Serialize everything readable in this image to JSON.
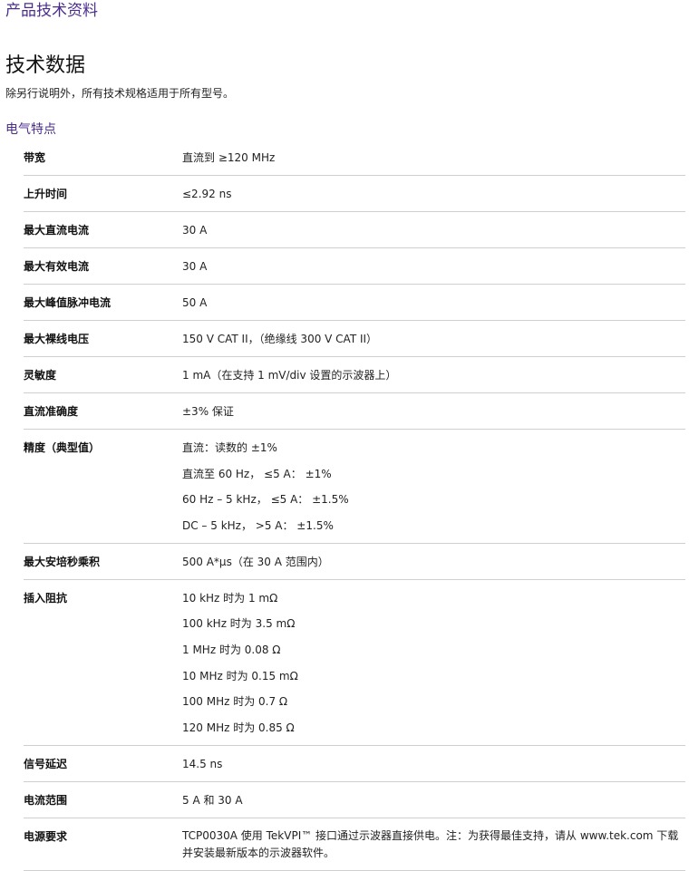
{
  "header": {
    "doc_label": "产品技术资料"
  },
  "section": {
    "title": "技术数据",
    "intro": "除另行说明外，所有技术规格适用于所有型号。",
    "subsection": "电气特点"
  },
  "specs": [
    {
      "label": "带宽",
      "values": [
        "直流到 ≥120 MHz"
      ]
    },
    {
      "label": "上升时间",
      "values": [
        "≤2.92 ns"
      ]
    },
    {
      "label": "最大直流电流",
      "values": [
        "30 A"
      ]
    },
    {
      "label": "最大有效电流",
      "values": [
        "30 A"
      ]
    },
    {
      "label": "最大峰值脉冲电流",
      "values": [
        "50 A"
      ]
    },
    {
      "label": "最大裸线电压",
      "values": [
        "150 V CAT II，（绝缘线 300 V CAT II）"
      ]
    },
    {
      "label": "灵敏度",
      "values": [
        "1 mA（在支持 1 mV/div 设置的示波器上）"
      ]
    },
    {
      "label": "直流准确度",
      "values": [
        "±3% 保证"
      ]
    },
    {
      "label": "精度（典型值）",
      "values": [
        "直流：读数的 ±1%",
        "直流至 60 Hz， ≤5 A： ±1%",
        "60 Hz – 5 kHz， ≤5 A： ±1.5%",
        "DC – 5 kHz， >5 A： ±1.5%"
      ]
    },
    {
      "label": "最大安培秒乘积",
      "values": [
        "500 A*μs（在 30 A 范围内）"
      ]
    },
    {
      "label": "插入阻抗",
      "values": [
        "10 kHz 时为 1 mΩ",
        "100 kHz 时为 3.5 mΩ",
        "1 MHz 时为 0.08 Ω",
        "10 MHz 时为 0.15 mΩ",
        "100 MHz 时为 0.7 Ω",
        "120 MHz 时为 0.85 Ω"
      ]
    },
    {
      "label": "信号延迟",
      "values": [
        "14.5 ns"
      ]
    },
    {
      "label": "电流范围",
      "values": [
        "5 A 和 30 A"
      ]
    },
    {
      "label": "电源要求",
      "values": [
        "TCP0030A 使用 TekVPI™ 接口通过示波器直接供电。注：为获得最佳支持，请从 www.tek.com 下载并安装最新版本的示波器软件。"
      ]
    }
  ]
}
